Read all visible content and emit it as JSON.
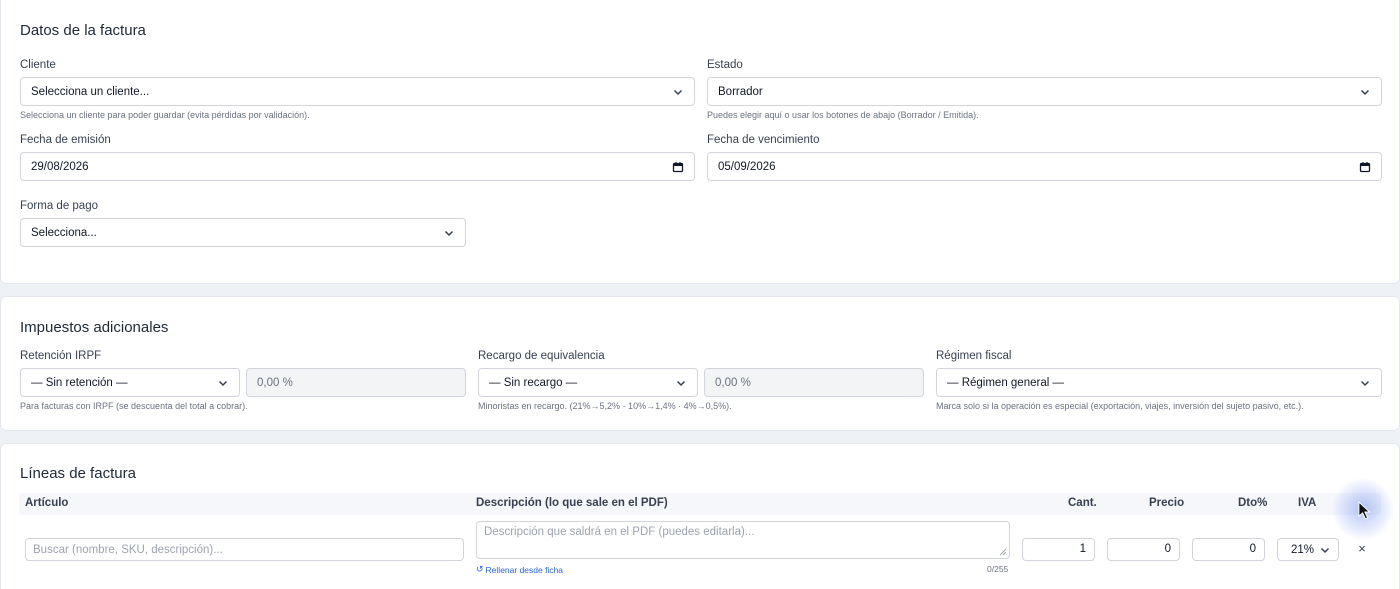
{
  "invoice": {
    "title": "Datos de la factura",
    "client_label": "Cliente",
    "client_value": "Selecciona un cliente...",
    "client_help": "Selecciona un cliente para poder guardar (evita pérdidas por validación).",
    "status_label": "Estado",
    "status_value": "Borrador",
    "status_help": "Puedes elegir aquí o usar los botones de abajo (Borrador / Emitida).",
    "issue_date_label": "Fecha de emisión",
    "issue_date_value": "29/08/2026",
    "due_date_label": "Fecha de vencimiento",
    "due_date_value": "05/09/2026",
    "payment_label": "Forma de pago",
    "payment_value": "Selecciona..."
  },
  "taxes": {
    "title": "Impuestos adicionales",
    "irpf_label": "Retención IRPF",
    "irpf_value": "— Sin retención —",
    "irpf_percent": "0,00 %",
    "irpf_help": "Para facturas con IRPF (se descuenta del total a cobrar).",
    "re_label": "Recargo de equivalencia",
    "re_value": "— Sin recargo —",
    "re_percent": "0,00 %",
    "re_help": "Minoristas en recargo. (21%→5,2% · 10%→1,4% · 4%→0,5%).",
    "regime_label": "Régimen fiscal",
    "regime_value": "— Régimen general —",
    "regime_help": "Marca solo si la operación es especial (exportación, viajes, inversión del sujeto pasivo, etc.)."
  },
  "lines": {
    "title": "Líneas de factura",
    "columns": {
      "article": "Artículo",
      "description": "Descripción (lo que sale en el PDF)",
      "qty": "Cant.",
      "price": "Precio",
      "discount": "Dto%",
      "vat": "IVA"
    },
    "row": {
      "article_placeholder": "Buscar (nombre, SKU, descripción)...",
      "description_placeholder": "Descripción que saldrá en el PDF (puedes editarla)...",
      "refill_link": "Rellenar desde ficha",
      "char_count": "0/255",
      "qty": "1",
      "price": "0",
      "discount": "0",
      "vat": "21%",
      "remove": "×"
    }
  },
  "icons": {
    "select": "chevron-down-icon",
    "date": "calendar-icon",
    "refill": "refresh-icon",
    "remove": "close-icon",
    "cursor": "mouse-pointer-icon"
  }
}
